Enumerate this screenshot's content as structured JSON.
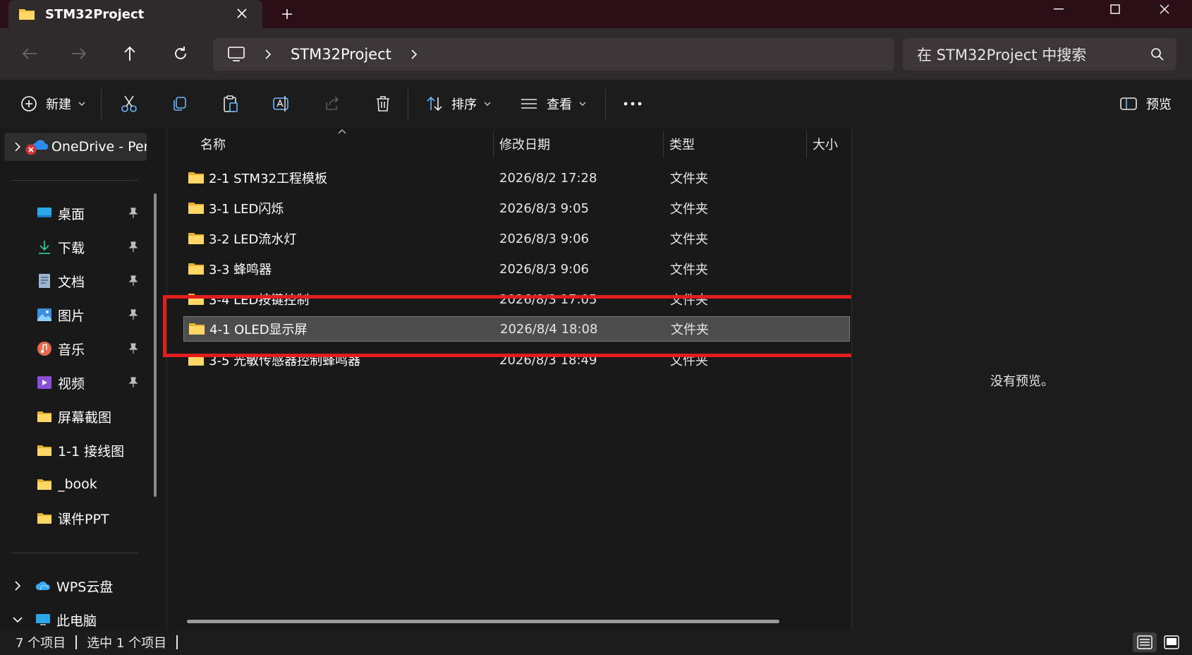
{
  "window": {
    "tab_title": "STM32Project"
  },
  "nav": {
    "address_segment": "STM32Project",
    "search_placeholder": "在 STM32Project 中搜索"
  },
  "toolbar": {
    "new_label": "新建",
    "sort_label": "排序",
    "view_label": "查看",
    "preview_label": "预览"
  },
  "sidebar": {
    "onedrive_label": "OneDrive - Per",
    "quick_access": [
      {
        "label": "桌面",
        "icon": "desktop-icon",
        "pinned": true
      },
      {
        "label": "下载",
        "icon": "download-icon",
        "pinned": true
      },
      {
        "label": "文档",
        "icon": "document-icon",
        "pinned": true
      },
      {
        "label": "图片",
        "icon": "pictures-icon",
        "pinned": true
      },
      {
        "label": "音乐",
        "icon": "music-icon",
        "pinned": true
      },
      {
        "label": "视频",
        "icon": "video-icon",
        "pinned": true
      },
      {
        "label": "屏幕截图",
        "icon": "folder-icon",
        "pinned": false
      },
      {
        "label": "1-1 接线图",
        "icon": "folder-icon",
        "pinned": false
      },
      {
        "label": "_book",
        "icon": "folder-icon",
        "pinned": false
      },
      {
        "label": "课件PPT",
        "icon": "folder-icon",
        "pinned": false
      }
    ],
    "wps_label": "WPS云盘",
    "thispc_label": "此电脑"
  },
  "filelist": {
    "columns": {
      "name": "名称",
      "modified": "修改日期",
      "type": "类型",
      "size": "大小"
    },
    "rows": [
      {
        "name": "2-1 STM32工程模板",
        "modified": "2026/8/2 17:28",
        "type": "文件夹"
      },
      {
        "name": "3-1 LED闪烁",
        "modified": "2026/8/3 9:05",
        "type": "文件夹"
      },
      {
        "name": "3-2 LED流水灯",
        "modified": "2026/8/3 9:06",
        "type": "文件夹"
      },
      {
        "name": "3-3 蜂鸣器",
        "modified": "2026/8/3 9:06",
        "type": "文件夹"
      },
      {
        "name": "3-4 LED按键控制",
        "modified": "2026/8/3 17:05",
        "type": "文件夹"
      },
      {
        "name": "4-1 OLED显示屏",
        "modified": "2026/8/4 18:08",
        "type": "文件夹",
        "selected": true
      },
      {
        "name": "3-5 光敏传感器控制蜂鸣器",
        "modified": "2026/8/3 18:49",
        "type": "文件夹"
      }
    ]
  },
  "preview": {
    "empty_text": "没有预览。"
  },
  "status": {
    "item_count": "7 个项目",
    "selected_count": "选中 1 个项目"
  },
  "colors": {
    "titlebar": "#2b0f16",
    "folder": "#f5c542",
    "highlight": "#e01e1e",
    "selected_row": "#4d4d4d"
  }
}
